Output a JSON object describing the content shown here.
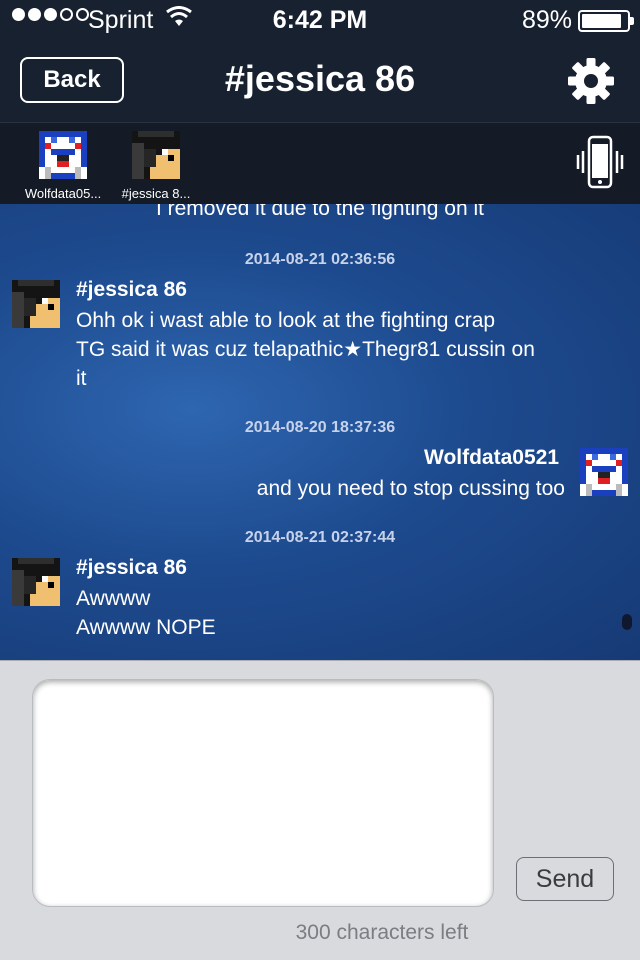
{
  "status_bar": {
    "carrier": "Sprint",
    "time": "6:42 PM",
    "battery": "89%",
    "battery_level": 0.89,
    "signal_bars": 3,
    "signal_total": 5
  },
  "nav": {
    "back_label": "Back",
    "title": "#jessica 86",
    "settings_icon": "gear-icon"
  },
  "participants": [
    {
      "name": "Wolfdata05...",
      "avatar": "wolfdata-avatar"
    },
    {
      "name": "#jessica 8...",
      "avatar": "jessica-avatar"
    }
  ],
  "chat": {
    "partial_message": "I removed it due to the fighting on it",
    "entries": [
      {
        "timestamp": "2014-08-21 02:36:56",
        "sender": "#jessica 86",
        "side": "left",
        "lines": [
          "Ohh ok i wast able to look at the fighting crap",
          "TG said it was cuz telapathic★Thegr81 cussin on",
          "it"
        ]
      },
      {
        "timestamp": "2014-08-20 18:37:36",
        "sender": "Wolfdata0521",
        "side": "right",
        "lines": [
          "and you need to stop cussing too"
        ]
      },
      {
        "timestamp": "2014-08-21 02:37:44",
        "sender": "#jessica 86",
        "side": "left",
        "lines": [
          "Awwww",
          "Awwww NOPE"
        ]
      }
    ]
  },
  "composer": {
    "message_value": "",
    "send_label": "Send",
    "characters_left": "300 characters left"
  },
  "colors": {
    "nav_bg": "#182130",
    "chat_bg": "#1d4a8e",
    "composer_bg": "#d8dadd"
  }
}
